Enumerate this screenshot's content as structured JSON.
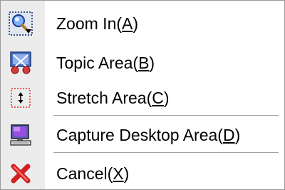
{
  "menu": {
    "items": [
      {
        "text": "Zoom In(",
        "key": "A",
        "close": ")",
        "icon": "zoom-in-icon",
        "selected": true
      },
      {
        "text": "Topic Area(",
        "key": "B",
        "close": ")",
        "icon": "topic-area-icon"
      },
      {
        "text": "Stretch Area(",
        "key": "C",
        "close": ")",
        "icon": "stretch-area-icon"
      },
      {
        "text": "Capture Desktop Area(",
        "key": "D",
        "close": ")",
        "icon": "capture-desktop-icon"
      },
      {
        "text": "Cancel(",
        "key": "X",
        "close": ")",
        "icon": "cancel-icon"
      }
    ]
  }
}
